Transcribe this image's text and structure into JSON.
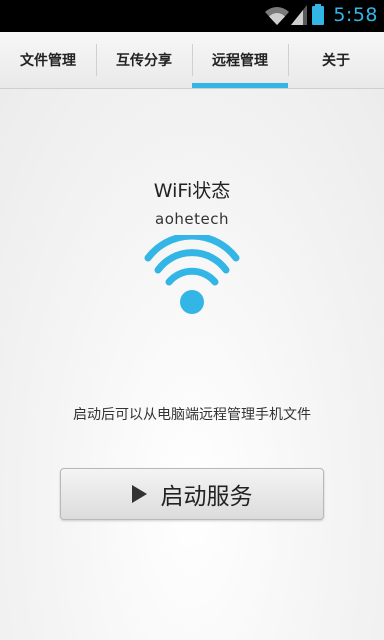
{
  "status_bar": {
    "time": "5:58",
    "icons": [
      "wifi-icon",
      "cell-signal-icon",
      "battery-icon"
    ],
    "accent": "#33b5e5"
  },
  "tabs": [
    {
      "label": "文件管理",
      "selected": false
    },
    {
      "label": "互传分享",
      "selected": false
    },
    {
      "label": "远程管理",
      "selected": true
    },
    {
      "label": "关于",
      "selected": false
    }
  ],
  "main": {
    "wifi_title": "WiFi状态",
    "ssid": "aohetech",
    "wifi_icon": "wifi-icon",
    "hint": "启动后可以从电脑端远程管理手机文件",
    "start_button": {
      "icon": "play-icon",
      "label": "启动服务"
    }
  },
  "colors": {
    "accent": "#33b5e5",
    "background": "#f2f2f2",
    "status_bar": "#000000"
  }
}
